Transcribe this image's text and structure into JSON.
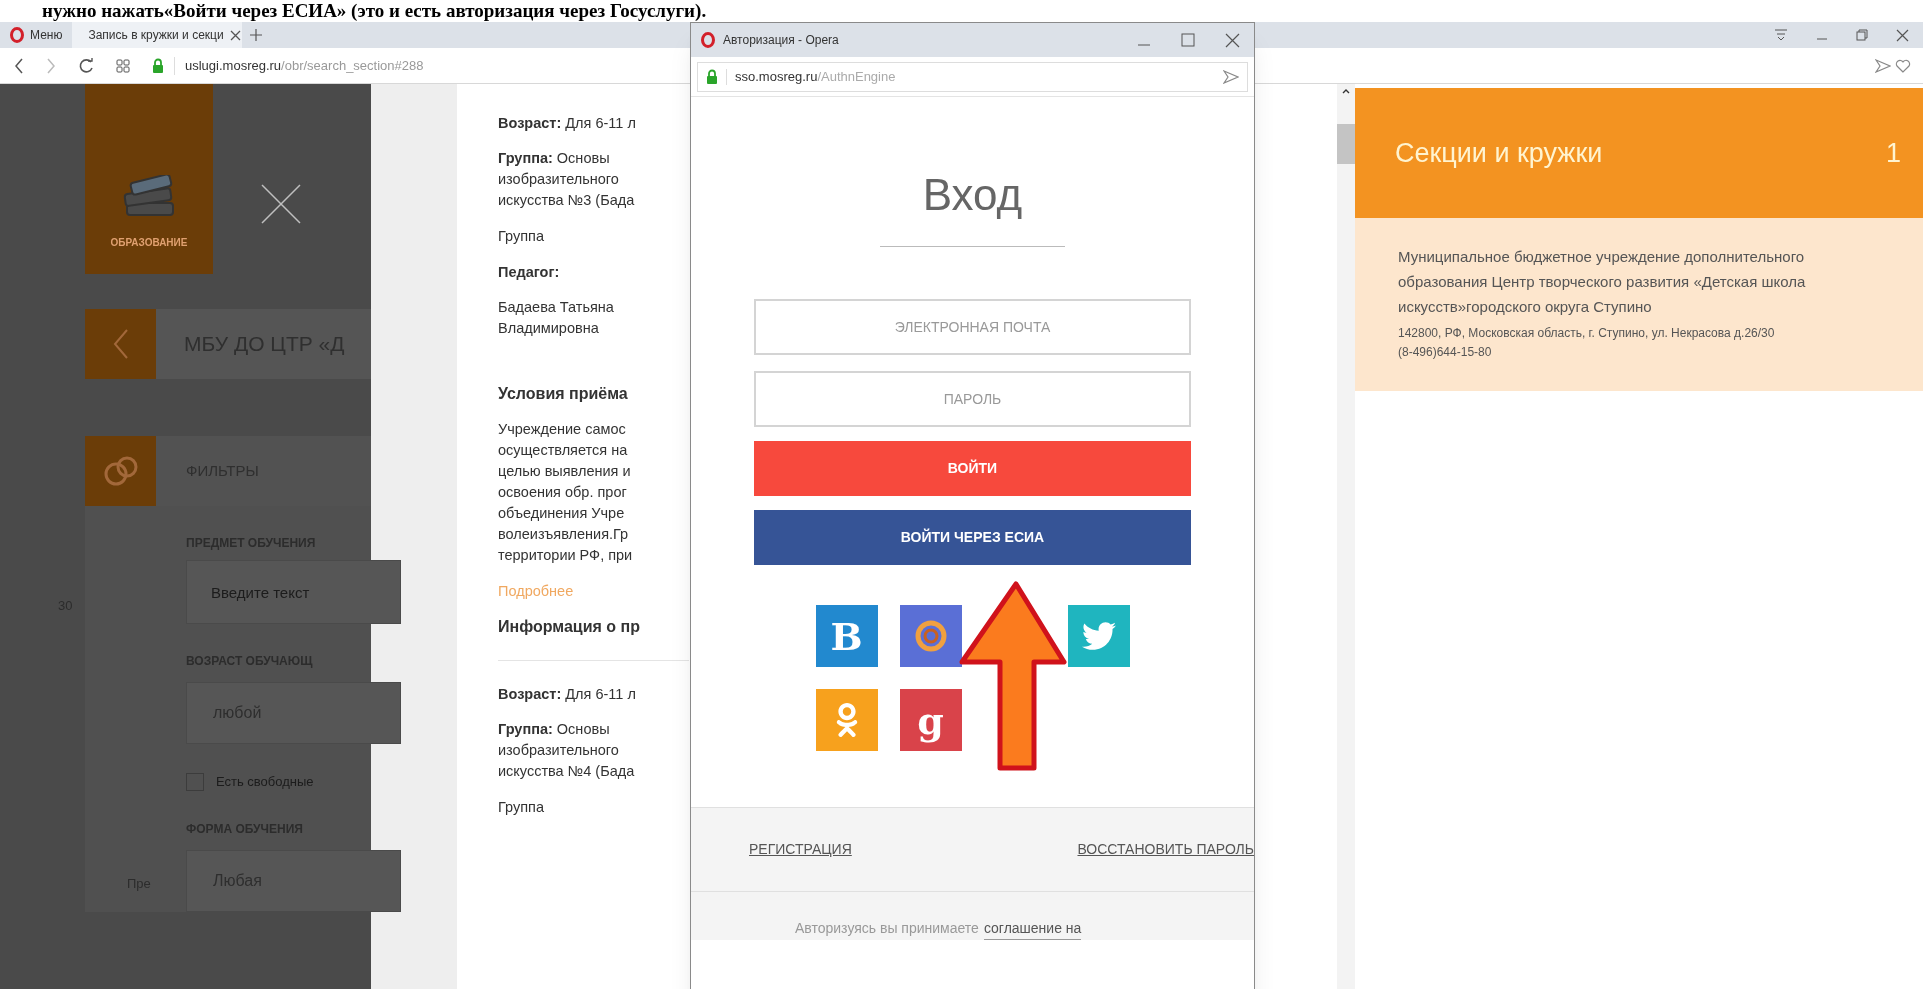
{
  "caption": "нужно нажать«Войти через ЕСИА» (это и есть авторизация через Госуслуги).",
  "browser": {
    "tabs": [
      {
        "label": "Меню",
        "kind": "menu",
        "selected": false
      },
      {
        "label": "Запись в кружки и секци",
        "kind": "page",
        "selected": true
      }
    ],
    "address": {
      "host": "uslugi.mosreg.ru",
      "path": "/obr/search_section#288"
    }
  },
  "map_labels": [
    "30",
    "Пре"
  ],
  "sidebar": {
    "category": "ОБРАЗОВАНИЕ",
    "breadcrumb": "МБУ ДО ЦТР «Д",
    "filters_title": "ФИЛЬТРЫ",
    "filters": [
      {
        "kind": "text",
        "label": "ПРЕДМЕТ ОБУЧЕНИЯ",
        "placeholder": "Введите текст"
      },
      {
        "kind": "select",
        "label": "ВОЗРАСТ ОБУЧАЮЩ",
        "value": "любой"
      },
      {
        "kind": "checkbox",
        "label": "Есть свободные",
        "checked": false
      },
      {
        "kind": "select",
        "label": "ФОРМА ОБУЧЕНИЯ",
        "value": "Любая"
      }
    ]
  },
  "results": [
    {
      "age": "**Возраст:** Для 6-11 л",
      "group_lines": [
        "**Группа:** Основы",
        "изобразительного",
        "искусства №3 (Бада"
      ],
      "group_type": "Группа",
      "teacher_label": "Педагог:",
      "teacher_lines": [
        "Бадаева Татьяна",
        "Владимировна"
      ],
      "conditions_title": "Условия приёма",
      "conditions_lines": [
        "Учреждение самос",
        "осуществляется на",
        "целью выявления и",
        "освоения обр. прог",
        "объединения Учре",
        "волеизъявления.Гр",
        "территории РФ, при"
      ],
      "more": "Подробнее",
      "info": "Информация о пр"
    },
    {
      "age": "**Возраст:** Для 6-11 л",
      "group_lines": [
        "**Группа:** Основы",
        "изобразительного",
        "искусства №4 (Бада"
      ],
      "group_type": "Группа"
    }
  ],
  "popup": {
    "title": "Авторизация - Opera",
    "address": {
      "host": "sso.mosreg.ru",
      "path": "/AuthnEngine"
    },
    "heading": "Вход",
    "fields": [
      {
        "placeholder": "ЭЛЕКТРОННАЯ ПОЧТА"
      },
      {
        "placeholder": "ПАРОЛЬ"
      }
    ],
    "buttons": [
      {
        "label": "ВОЙТИ",
        "kind": "primary"
      },
      {
        "label": "ВОЙТИ ЧЕРЕЗ ЕСИА",
        "kind": "esia"
      }
    ],
    "socials": [
      {
        "kind": "letter",
        "label": "B",
        "color": "#2289cf"
      },
      {
        "kind": "ring",
        "color": "#5a6fd6"
      },
      {
        "kind": "bird",
        "color": "#1fb5bf"
      },
      {
        "kind": "ok",
        "color": "#f7a11d"
      },
      {
        "kind": "letter",
        "label": "g",
        "color": "#d9434a"
      }
    ],
    "register": "РЕГИСТРАЦИЯ",
    "restore": "ВОССТАНОВИТЬ ПАРОЛЬ",
    "consent": "Авторизуясь вы принимаете",
    "consent_link": "соглашение на"
  },
  "panel": {
    "title": "Секции и кружки",
    "count": "1",
    "org": "Муниципальное бюджетное учреждение дополнительного образования Центр творческого развития «Детская школа искусств»городского округа Ступино",
    "address": "142800, РФ, Московская область, г. Ступино, ул. Некрасова д.26/30",
    "phone": "(8-496)644-15-80"
  }
}
